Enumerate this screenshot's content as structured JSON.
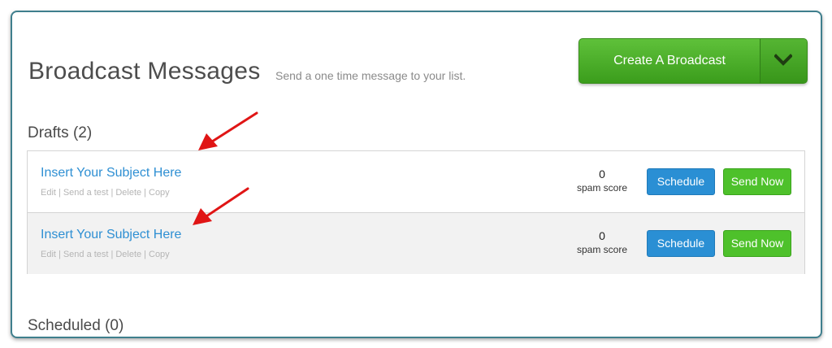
{
  "header": {
    "title": "Broadcast Messages",
    "subtitle": "Send a one time message to your list.",
    "create_button_label": "Create A Broadcast",
    "dropdown_icon": "chevron-down-icon"
  },
  "drafts": {
    "heading": "Drafts (2)",
    "items": [
      {
        "subject": "Insert Your Subject Here",
        "actions": [
          "Edit",
          "Send a test",
          "Delete",
          "Copy"
        ],
        "spam_score": "0",
        "spam_label": "spam score",
        "schedule_label": "Schedule",
        "send_now_label": "Send Now"
      },
      {
        "subject": "Insert Your Subject Here",
        "actions": [
          "Edit",
          "Send a test",
          "Delete",
          "Copy"
        ],
        "spam_score": "0",
        "spam_label": "spam score",
        "schedule_label": "Schedule",
        "send_now_label": "Send Now"
      }
    ]
  },
  "scheduled": {
    "heading": "Scheduled (0)"
  },
  "colors": {
    "primary_green": "#4ec12b",
    "primary_blue": "#2a8fd4",
    "link_blue": "#2e8fd3",
    "annotation_red": "#e01515"
  }
}
